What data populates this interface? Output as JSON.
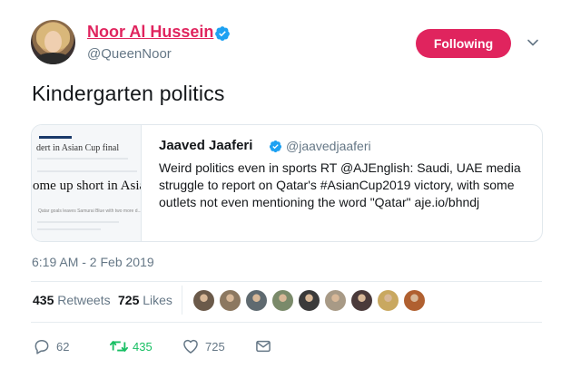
{
  "author": {
    "display_name": "Noor Al Hussein",
    "handle": "@QueenNoor"
  },
  "follow_button": {
    "label": "Following"
  },
  "tweet": {
    "text": "Kindergarten politics",
    "timestamp": "6:19 AM - 2 Feb 2019"
  },
  "quoted_tweet": {
    "display_name": "Jaaved Jaaferi",
    "handle": "@jaavedjaaferi",
    "text": "Weird politics even in sports RT @AJEnglish: Saudi, UAE media struggle to report on Qatar's #AsianCup2019 victory, with some outlets not even mentioning the word \"Qatar\" aje.io/bhndj",
    "image": {
      "line1": "dert in Asian Cup final",
      "line2": "ome up short in Asian",
      "line3": "Qatar goals leaves Samurai Blue with two more d..."
    }
  },
  "stats": {
    "retweets_count": "435",
    "retweets_label": "Retweets",
    "likes_count": "725",
    "likes_label": "Likes"
  },
  "liker_avatars": [
    {
      "color": "#6b5a4a"
    },
    {
      "color": "#8c7860"
    },
    {
      "color": "#5f6a70"
    },
    {
      "color": "#7a8a6a"
    },
    {
      "color": "#3a3a3a"
    },
    {
      "color": "#a89a86"
    },
    {
      "color": "#4a3a3a"
    },
    {
      "color": "#c9a860"
    },
    {
      "color": "#b06030"
    }
  ],
  "actions": {
    "reply_count": "62",
    "retweet_count": "435",
    "like_count": "725"
  },
  "colors": {
    "accent": "#e0245e",
    "verified": "#1da1f2",
    "retweet_green": "#17bf63",
    "muted": "#657786"
  }
}
